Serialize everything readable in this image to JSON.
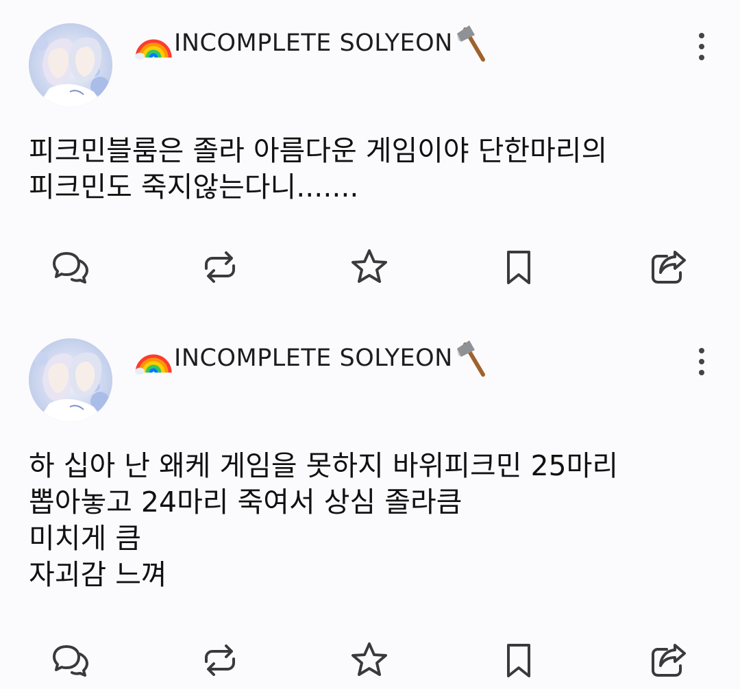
{
  "posts": [
    {
      "author": "INCOMPLETE SOLYEON",
      "author_prefix_icon": "rainbow-icon",
      "author_suffix_icon": "axe-icon",
      "text": "피크민블룸은 졸라 아름다운 게임이야 단한마리의\n피크민도 죽지않는다니.......",
      "actions": [
        "reply-icon",
        "repost-icon",
        "star-icon",
        "bookmark-icon",
        "share-icon"
      ]
    },
    {
      "author": "INCOMPLETE SOLYEON",
      "author_prefix_icon": "rainbow-icon",
      "author_suffix_icon": "axe-icon",
      "text": "하 십아 난 왜케 게임을 못하지 바위피크민 25마리\n뽑아놓고 24마리 죽여서 상심 졸라큼\n미치게 큼\n자괴감 느껴",
      "actions": [
        "reply-icon",
        "repost-icon",
        "star-icon",
        "bookmark-icon",
        "share-icon"
      ]
    }
  ],
  "colors": {
    "background": "#fbfbfd",
    "text": "#111111",
    "icon": "#3a3a3c"
  }
}
